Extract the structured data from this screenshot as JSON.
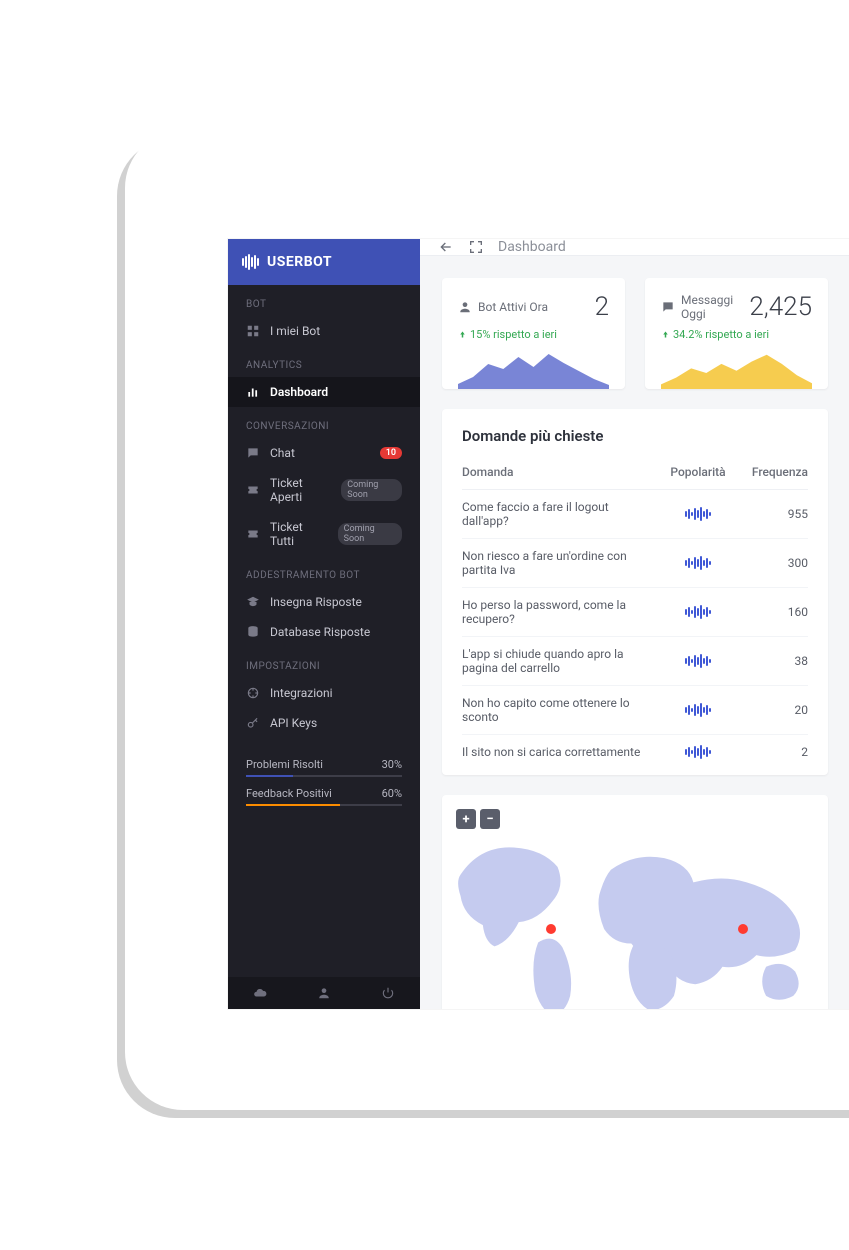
{
  "brand": "USERBOT",
  "topbar": {
    "title": "Dashboard"
  },
  "colors": {
    "brand": "#3f51b5",
    "sidebar_bg": "#1f1f27",
    "accent_blue": "#6a78d1",
    "accent_yellow": "#f5c63c",
    "accent_orange": "#fb8c00",
    "badge_red": "#e53935",
    "delta_up": "#33a852"
  },
  "sidebar": {
    "sections": [
      {
        "label": "BOT",
        "items": [
          {
            "id": "my-bots",
            "icon": "grid-icon",
            "label": "I miei Bot"
          }
        ]
      },
      {
        "label": "ANALYTICS",
        "items": [
          {
            "id": "dashboard",
            "icon": "chart-icon",
            "label": "Dashboard",
            "active": true
          }
        ]
      },
      {
        "label": "CONVERSAZIONI",
        "items": [
          {
            "id": "chat",
            "icon": "chat-icon",
            "label": "Chat",
            "badge": {
              "type": "count",
              "value": "10"
            }
          },
          {
            "id": "tickets-open",
            "icon": "ticket-icon",
            "label": "Ticket Aperti",
            "badge": {
              "type": "soon",
              "value": "Coming Soon"
            }
          },
          {
            "id": "tickets-all",
            "icon": "ticket-icon",
            "label": "Ticket Tutti",
            "badge": {
              "type": "soon",
              "value": "Coming Soon"
            }
          }
        ]
      },
      {
        "label": "ADDESTRAMENTO BOT",
        "items": [
          {
            "id": "teach",
            "icon": "teach-icon",
            "label": "Insegna Risposte"
          },
          {
            "id": "database",
            "icon": "database-icon",
            "label": "Database Risposte"
          }
        ]
      },
      {
        "label": "IMPOSTAZIONI",
        "items": [
          {
            "id": "integrations",
            "icon": "plug-icon",
            "label": "Integrazioni"
          },
          {
            "id": "api-keys",
            "icon": "key-icon",
            "label": "API Keys"
          }
        ]
      }
    ],
    "progress": [
      {
        "label": "Problemi Risolti",
        "value": "30%",
        "fill": 30,
        "color": "#3f51b5"
      },
      {
        "label": "Feedback Positivi",
        "value": "60%",
        "fill": 60,
        "color": "#fb8c00"
      }
    ],
    "footer_icons": [
      "cloud-icon",
      "user-icon",
      "power-icon"
    ]
  },
  "kpis": [
    {
      "id": "bots-active",
      "icon": "person-icon",
      "title": "Bot Attivi Ora",
      "value": "2",
      "delta": "15% rispetto a ieri",
      "spark_color": "#6a78d1"
    },
    {
      "id": "messages-today",
      "icon": "message-icon",
      "title": "Messaggi Oggi",
      "value": "2,425",
      "delta": "34.2% rispetto a ieri",
      "spark_color": "#f5c63c"
    }
  ],
  "questions_table": {
    "title": "Domande più chieste",
    "headers": {
      "question": "Domanda",
      "popularity": "Popolarità",
      "frequency": "Frequenza"
    },
    "rows": [
      {
        "q": "Come faccio a fare il logout dall'app?",
        "freq": "955"
      },
      {
        "q": "Non riesco a fare un'ordine con partita Iva",
        "freq": "300"
      },
      {
        "q": "Ho perso la password, come la recupero?",
        "freq": "160"
      },
      {
        "q": "L'app si chiude quando apro la pagina del carrello",
        "freq": "38"
      },
      {
        "q": "Non ho capito come ottenere lo sconto",
        "freq": "20"
      },
      {
        "q": "Il sito non si carica correttamente",
        "freq": "2"
      }
    ]
  },
  "map": {
    "zoom_plus": "+",
    "zoom_minus": "−",
    "points": [
      {
        "x_pct": 25,
        "y_pct": 48
      },
      {
        "x_pct": 76,
        "y_pct": 48
      }
    ]
  },
  "chart_data": [
    {
      "type": "area",
      "title": "Bot Attivi Ora sparkline",
      "x": [
        0,
        1,
        2,
        3,
        4,
        5,
        6,
        7,
        8,
        9,
        10
      ],
      "values": [
        5,
        12,
        25,
        20,
        32,
        22,
        35,
        26,
        18,
        10,
        4
      ],
      "ylim": [
        0,
        40
      ],
      "color": "#6a78d1"
    },
    {
      "type": "area",
      "title": "Messaggi Oggi sparkline",
      "x": [
        0,
        1,
        2,
        3,
        4,
        5,
        6,
        7,
        8,
        9,
        10
      ],
      "values": [
        4,
        10,
        18,
        14,
        22,
        16,
        24,
        30,
        22,
        12,
        5
      ],
      "ylim": [
        0,
        35
      ],
      "color": "#f5c63c"
    }
  ]
}
